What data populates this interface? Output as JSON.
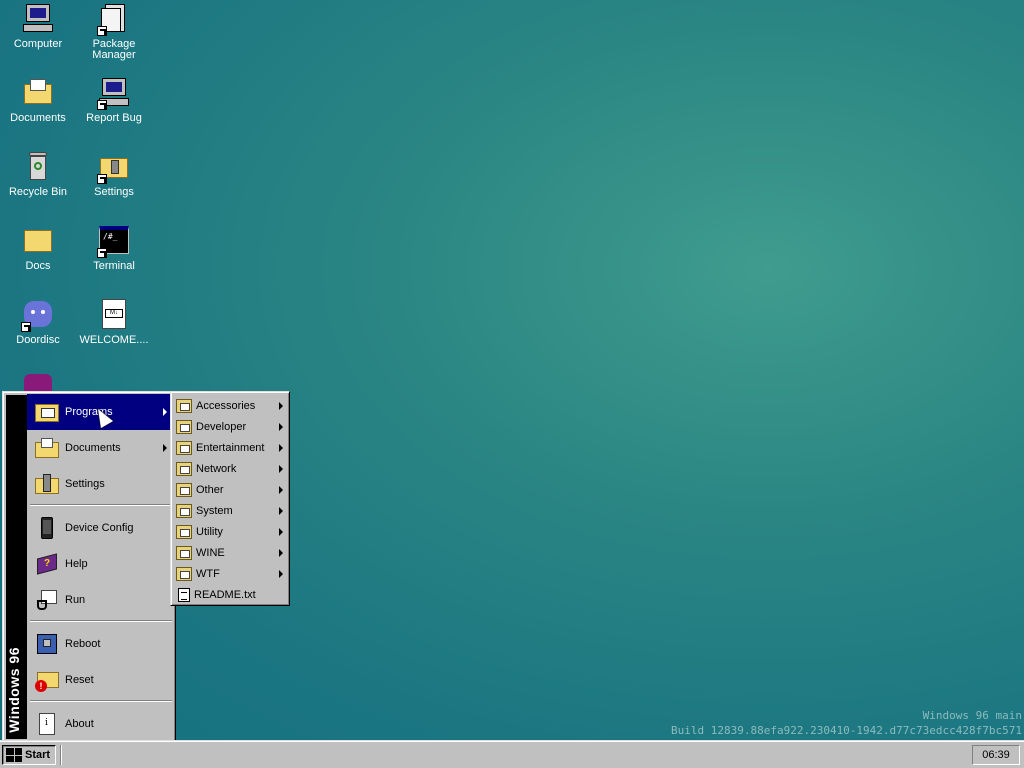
{
  "desktop": {
    "icons": [
      {
        "label": "Computer",
        "icon": "computer-icon"
      },
      {
        "label": "Package Manager",
        "icon": "package-manager-icon"
      },
      {
        "label": "Documents",
        "icon": "documents-folder-icon"
      },
      {
        "label": "Report Bug",
        "icon": "report-bug-icon"
      },
      {
        "label": "Recycle Bin",
        "icon": "recycle-bin-icon"
      },
      {
        "label": "Settings",
        "icon": "settings-icon"
      },
      {
        "label": "Docs",
        "icon": "folder-icon"
      },
      {
        "label": "Terminal",
        "icon": "terminal-icon"
      },
      {
        "label": "Doordisc",
        "icon": "doordisc-icon"
      },
      {
        "label": "WELCOME....",
        "icon": "markdown-file-icon"
      }
    ],
    "watermark": {
      "line1": "Windows 96 main",
      "line2": "Build 12839.88efa922.230410-1942.d77c73edcc428f7bc571"
    }
  },
  "start_menu": {
    "band_text": "Windows 96",
    "items": [
      {
        "label": "Programs",
        "icon": "programs-icon",
        "submenu": true,
        "active": true
      },
      {
        "label": "Documents",
        "icon": "documents-icon",
        "submenu": true
      },
      {
        "label": "Settings",
        "icon": "settings-icon",
        "submenu": false
      },
      {
        "label": "Device Config",
        "icon": "device-config-icon",
        "submenu": false
      },
      {
        "label": "Help",
        "icon": "help-book-icon",
        "submenu": false
      },
      {
        "label": "Run",
        "icon": "run-icon",
        "submenu": false
      },
      {
        "label": "Reboot",
        "icon": "reboot-icon",
        "submenu": false
      },
      {
        "label": "Reset",
        "icon": "reset-icon",
        "submenu": false
      },
      {
        "label": "About",
        "icon": "about-icon",
        "submenu": false
      }
    ]
  },
  "programs_menu": {
    "items": [
      {
        "label": "Accessories",
        "submenu": true
      },
      {
        "label": "Developer",
        "submenu": true
      },
      {
        "label": "Entertainment",
        "submenu": true
      },
      {
        "label": "Network",
        "submenu": true
      },
      {
        "label": "Other",
        "submenu": true
      },
      {
        "label": "System",
        "submenu": true
      },
      {
        "label": "Utility",
        "submenu": true
      },
      {
        "label": "WINE",
        "submenu": true
      },
      {
        "label": "WTF",
        "submenu": true
      },
      {
        "label": "README.txt",
        "submenu": false
      }
    ]
  },
  "taskbar": {
    "start_label": "Start",
    "clock": "06:39"
  },
  "colors": {
    "desktop_bg": "#1f7c82",
    "menu_highlight": "#000080",
    "menu_bg": "#c0c0c0"
  }
}
